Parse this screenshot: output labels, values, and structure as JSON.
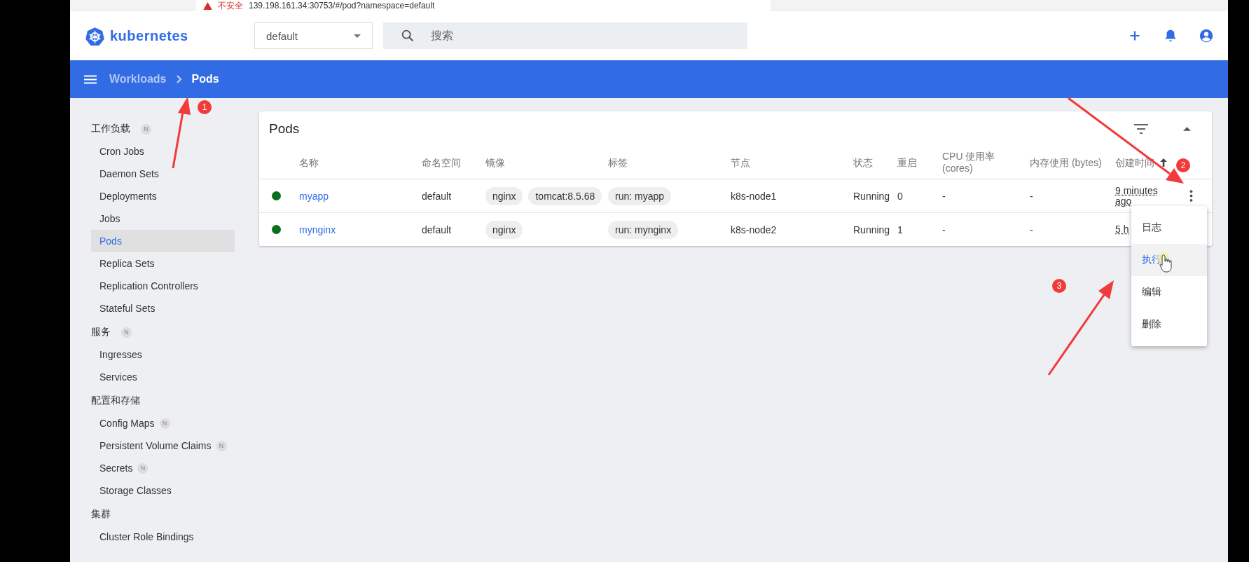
{
  "browser": {
    "security": "不安全",
    "url": "139.198.161.34:30753/#/pod?namespace=default"
  },
  "header": {
    "logo": "kubernetes",
    "namespace": "default",
    "search": {
      "placeholder": "搜索"
    }
  },
  "breadcrumb": [
    {
      "label": "Workloads",
      "current": false
    },
    {
      "label": "Pods",
      "current": true
    }
  ],
  "sidebar": [
    {
      "heading": "工作负载",
      "badge": "N",
      "items": [
        {
          "label": "Cron Jobs",
          "selected": false
        },
        {
          "label": "Daemon Sets",
          "selected": false
        },
        {
          "label": "Deployments",
          "selected": false
        },
        {
          "label": "Jobs",
          "selected": false
        },
        {
          "label": "Pods",
          "selected": true
        },
        {
          "label": "Replica Sets",
          "selected": false
        },
        {
          "label": "Replication Controllers",
          "selected": false
        },
        {
          "label": "Stateful Sets",
          "selected": false
        }
      ]
    },
    {
      "heading": "服务",
      "badge": "N",
      "items": [
        {
          "label": "Ingresses",
          "selected": false
        },
        {
          "label": "Services",
          "selected": false
        }
      ]
    },
    {
      "heading": "配置和存储",
      "items": [
        {
          "label": "Config Maps",
          "badge": "N",
          "selected": false
        },
        {
          "label": "Persistent Volume Claims",
          "badge": "N",
          "selected": false
        },
        {
          "label": "Secrets",
          "badge": "N",
          "selected": false
        },
        {
          "label": "Storage Classes",
          "selected": false
        }
      ]
    },
    {
      "heading": "集群",
      "items": [
        {
          "label": "Cluster Role Bindings",
          "selected": false
        }
      ]
    }
  ],
  "card": {
    "title": "Pods",
    "columns": [
      {
        "label": "名称"
      },
      {
        "label": "命名空间"
      },
      {
        "label": "镜像"
      },
      {
        "label": "标签"
      },
      {
        "label": "节点"
      },
      {
        "label": "状态"
      },
      {
        "label": "重启"
      },
      {
        "label": "CPU 使用率 (cores)"
      },
      {
        "label": "内存使用 (bytes)"
      },
      {
        "label": "创建时间",
        "sorted": true
      }
    ],
    "rows": [
      {
        "color": "#0b6e1f",
        "name": "myapp",
        "namespace": "default",
        "images": [
          "nginx",
          "tomcat:8.5.68"
        ],
        "labels": [
          "run: myapp"
        ],
        "node": "k8s-node1",
        "status": "Running",
        "restarts": "0",
        "cpu": "-",
        "memory": "-",
        "created": "9 minutes ago",
        "menu": true
      },
      {
        "color": "#0b6e1f",
        "name": "mynginx",
        "namespace": "default",
        "images": [
          "nginx"
        ],
        "labels": [
          "run: mynginx"
        ],
        "node": "k8s-node2",
        "status": "Running",
        "restarts": "1",
        "cpu": "-",
        "memory": "-",
        "created": "5 h",
        "menu": false
      }
    ]
  },
  "menu": [
    {
      "label": "日志",
      "selected": false
    },
    {
      "label": "执行",
      "selected": true
    },
    {
      "label": "编辑",
      "selected": false
    },
    {
      "label": "删除",
      "selected": false
    }
  ],
  "annotations": [
    "1",
    "2",
    "3"
  ]
}
